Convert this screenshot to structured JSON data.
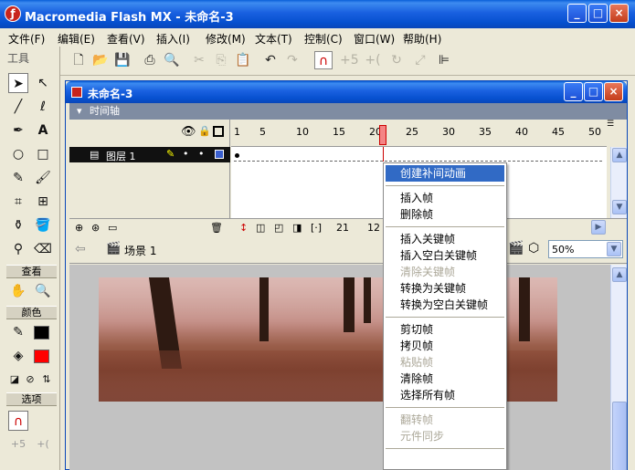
{
  "app": {
    "title": "Macromedia Flash MX - 未命名-3",
    "min": "_",
    "max": "□",
    "close": "×"
  },
  "menubar": [
    "文件(F)",
    "编辑(E)",
    "查看(V)",
    "插入(I)",
    "修改(M)",
    "文本(T)",
    "控制(C)",
    "窗口(W)",
    "帮助(H)"
  ],
  "tools": {
    "title": "工具",
    "view_title": "查看",
    "color_title": "颜色",
    "options_title": "选项"
  },
  "doc": {
    "title": "未命名-3",
    "timeline_label": "时间轴",
    "layer_name": "图层 1",
    "ruler": [
      "1",
      "5",
      "10",
      "15",
      "20",
      "25",
      "30",
      "35",
      "40",
      "45",
      "50"
    ],
    "current_frame": "21",
    "fps_partial": "12",
    "scene": "场景 1",
    "zoom": "50%"
  },
  "context_menu": [
    {
      "label": "创建补间动画",
      "state": "hl"
    },
    {
      "sep": true
    },
    {
      "label": "插入帧",
      "state": ""
    },
    {
      "label": "删除帧",
      "state": ""
    },
    {
      "sep": true
    },
    {
      "label": "插入关键帧",
      "state": ""
    },
    {
      "label": "插入空白关键帧",
      "state": ""
    },
    {
      "label": "清除关键帧",
      "state": "dis"
    },
    {
      "label": "转换为关键帧",
      "state": ""
    },
    {
      "label": "转换为空白关键帧",
      "state": ""
    },
    {
      "sep": true
    },
    {
      "label": "剪切帧",
      "state": ""
    },
    {
      "label": "拷贝帧",
      "state": ""
    },
    {
      "label": "粘贴帧",
      "state": "dis"
    },
    {
      "label": "清除帧",
      "state": ""
    },
    {
      "label": "选择所有帧",
      "state": ""
    },
    {
      "sep": true
    },
    {
      "label": "翻转帧",
      "state": "dis"
    },
    {
      "label": "元件同步",
      "state": "dis"
    }
  ]
}
